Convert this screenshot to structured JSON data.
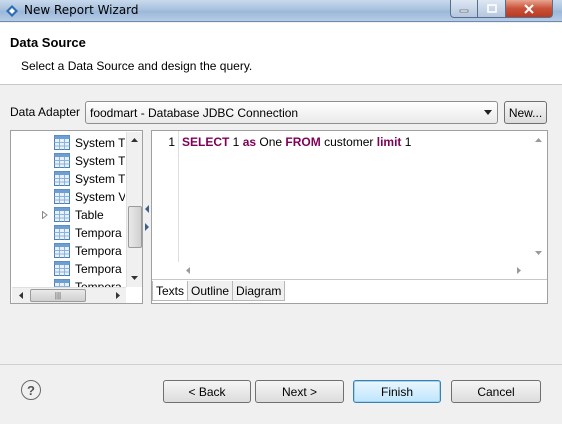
{
  "window": {
    "title": "New Report Wizard"
  },
  "header": {
    "title": "Data Source",
    "description": "Select a Data Source and design the query."
  },
  "adapter": {
    "label": "Data Adapter",
    "selected": "foodmart - Database JDBC Connection",
    "new_button": "New..."
  },
  "tree": {
    "items": [
      {
        "label": "System T",
        "expandable": false
      },
      {
        "label": "System T",
        "expandable": false
      },
      {
        "label": "System T",
        "expandable": false
      },
      {
        "label": "System V",
        "expandable": false
      },
      {
        "label": "Table",
        "expandable": true
      },
      {
        "label": "Tempora",
        "expandable": false
      },
      {
        "label": "Tempora",
        "expandable": false
      },
      {
        "label": "Tempora",
        "expandable": false
      },
      {
        "label": "Tempora",
        "expandable": false
      }
    ]
  },
  "editor": {
    "line_number": "1",
    "tokens": [
      {
        "text": "SELECT",
        "keyword": true
      },
      {
        "text": " 1 ",
        "keyword": false
      },
      {
        "text": "as",
        "keyword": true
      },
      {
        "text": " One ",
        "keyword": false
      },
      {
        "text": "FROM",
        "keyword": true
      },
      {
        "text": " customer ",
        "keyword": false
      },
      {
        "text": "limit",
        "keyword": true
      },
      {
        "text": " 1",
        "keyword": false
      }
    ],
    "tabs": [
      "Texts",
      "Outline",
      "Diagram"
    ],
    "active_tab": "Texts"
  },
  "footer": {
    "help_label": "?",
    "back": "< Back",
    "next": "Next >",
    "finish": "Finish",
    "cancel": "Cancel"
  },
  "colors": {
    "keyword": "#7f0055",
    "default_button_border": "#3c7fb1"
  }
}
